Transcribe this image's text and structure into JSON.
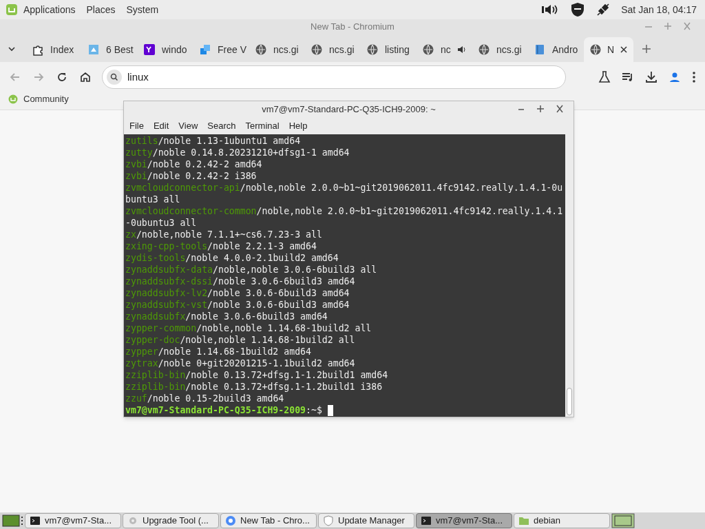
{
  "top_panel": {
    "menus": [
      "Applications",
      "Places",
      "System"
    ],
    "clock": "Sat Jan 18, 04:17"
  },
  "browser": {
    "title": "New Tab - Chromium",
    "tabs": [
      {
        "label": "Index",
        "kind": "puzzle",
        "selected": false
      },
      {
        "label": "6 Best",
        "kind": "square",
        "selected": false
      },
      {
        "label": "windo",
        "kind": "yahoo",
        "selected": false
      },
      {
        "label": "Free V",
        "kind": "cubes",
        "selected": false
      },
      {
        "label": "ncs.gi",
        "kind": "globe",
        "selected": false
      },
      {
        "label": "ncs.gi",
        "kind": "globe",
        "selected": false
      },
      {
        "label": "listing",
        "kind": "globe",
        "selected": false
      },
      {
        "label": "nc",
        "kind": "globe",
        "audio": true,
        "selected": false
      },
      {
        "label": "ncs.gi",
        "kind": "globe",
        "selected": false
      },
      {
        "label": "Andro",
        "kind": "book",
        "selected": false
      },
      {
        "label": "N",
        "kind": "globe",
        "selected": true
      }
    ],
    "address": "linux",
    "bookmarks": [
      "Community"
    ]
  },
  "terminal": {
    "title": "vm7@vm7-Standard-PC-Q35-ICH9-2009: ~",
    "menus": [
      "File",
      "Edit",
      "View",
      "Search",
      "Terminal",
      "Help"
    ],
    "lines": [
      {
        "package": "zutils",
        "rest": "/noble 1.13-1ubuntu1 amd64"
      },
      {
        "package": "zutty",
        "rest": "/noble 0.14.8.20231210+dfsg1-1 amd64"
      },
      {
        "package": "zvbi",
        "rest": "/noble 0.2.42-2 amd64"
      },
      {
        "package": "zvbi",
        "rest": "/noble 0.2.42-2 i386"
      },
      {
        "package": "zvmcloudconnector-api",
        "rest": "/noble,noble 2.0.0~b1~git2019062011.4fc9142.really.1.4.1-0u"
      },
      {
        "rest": "buntu3 all"
      },
      {
        "package": "zvmcloudconnector-common",
        "rest": "/noble,noble 2.0.0~b1~git2019062011.4fc9142.really.1.4.1"
      },
      {
        "rest": "-0ubuntu3 all"
      },
      {
        "package": "zx",
        "rest": "/noble,noble 7.1.1+~cs6.7.23-3 all"
      },
      {
        "package": "zxing-cpp-tools",
        "rest": "/noble 2.2.1-3 amd64"
      },
      {
        "package": "zydis-tools",
        "rest": "/noble 4.0.0-2.1build2 amd64"
      },
      {
        "package": "zynaddsubfx-data",
        "rest": "/noble,noble 3.0.6-6build3 all"
      },
      {
        "package": "zynaddsubfx-dssi",
        "rest": "/noble 3.0.6-6build3 amd64"
      },
      {
        "package": "zynaddsubfx-lv2",
        "rest": "/noble 3.0.6-6build3 amd64"
      },
      {
        "package": "zynaddsubfx-vst",
        "rest": "/noble 3.0.6-6build3 amd64"
      },
      {
        "package": "zynaddsubfx",
        "rest": "/noble 3.0.6-6build3 amd64"
      },
      {
        "package": "zypper-common",
        "rest": "/noble,noble 1.14.68-1build2 all"
      },
      {
        "package": "zypper-doc",
        "rest": "/noble,noble 1.14.68-1build2 all"
      },
      {
        "package": "zypper",
        "rest": "/noble 1.14.68-1build2 amd64"
      },
      {
        "package": "zytrax",
        "rest": "/noble 0+git20201215-1.1build2 amd64"
      },
      {
        "package": "zziplib-bin",
        "rest": "/noble 0.13.72+dfsg.1-1.2build1 amd64"
      },
      {
        "package": "zziplib-bin",
        "rest": "/noble 0.13.72+dfsg.1-1.2build1 i386"
      },
      {
        "package": "zzuf",
        "rest": "/noble 0.15-2build3 amd64"
      }
    ],
    "prompt": {
      "user_host": "vm7@vm7-Standard-PC-Q35-ICH9-2009",
      "path": ":~$"
    }
  },
  "taskbar": [
    {
      "label": "vm7@vm7-Sta...",
      "kind": "terminal",
      "selected": false
    },
    {
      "label": "Upgrade Tool (...",
      "kind": "gear",
      "selected": false
    },
    {
      "label": "New Tab - Chro...",
      "kind": "chromium",
      "selected": false
    },
    {
      "label": "Update Manager",
      "kind": "shield",
      "selected": false
    },
    {
      "label": "vm7@vm7-Sta...",
      "kind": "terminal",
      "selected": true
    },
    {
      "label": "debian",
      "kind": "folder",
      "selected": false
    }
  ]
}
